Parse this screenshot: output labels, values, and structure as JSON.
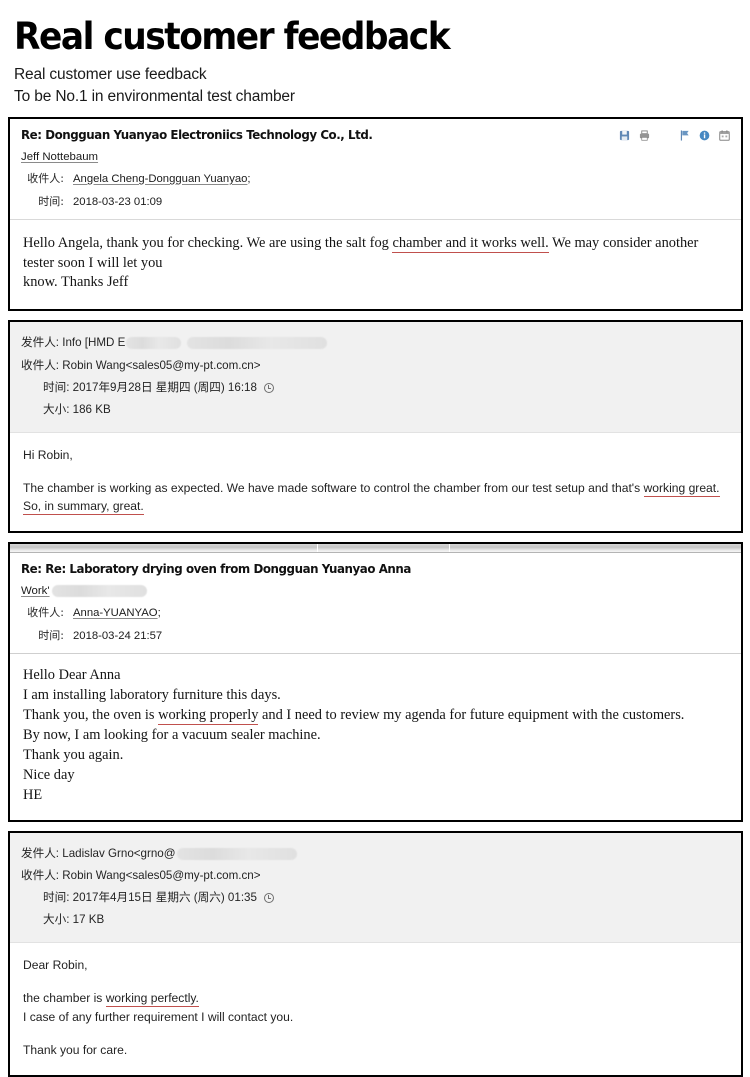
{
  "header": {
    "title": "Real customer feedback",
    "sub1": "Real customer use feedback",
    "sub2": "To be No.1 in environmental test chamber"
  },
  "accent_red": "#c0504d",
  "icons": {
    "save": "save-icon",
    "print": "print-icon",
    "flag": "flag-icon",
    "info": "info-icon",
    "calendar": "calendar-icon"
  },
  "emails": [
    {
      "style": "white",
      "subject": "Re: Dongguan Yuanyao Electroniics Technology Co., Ltd.",
      "sender": "Jeff Nottebaum",
      "to_label": "收件人:",
      "to_value": "Angela Cheng-Dongguan Yuanyao",
      "to_suffix": ";",
      "time_label": "时间:",
      "time_value": "2018-03-23 01:09",
      "body_lines": [
        {
          "parts": [
            {
              "t": "Hello Angela, thank you for checking. We are using the salt fog ",
              "hl": false
            },
            {
              "t": "chamber and it works well.",
              "hl": true
            },
            {
              "t": " We may consider another tester soon I will let you",
              "hl": false
            }
          ]
        },
        {
          "parts": [
            {
              "t": "know. Thanks Jeff",
              "hl": false
            }
          ]
        }
      ]
    },
    {
      "style": "gray",
      "from_label": "发件人:",
      "from_value": "Info [HMD E",
      "from_redacted": true,
      "to_label": "收件人:",
      "to_value": "Robin Wang<sales05@my-pt.com.cn>",
      "time_label": "时间:",
      "time_value": "2017年9月28日 星期四 (周四) 16:18",
      "size_label": "大小:",
      "size_value": "186 KB",
      "body_lines": [
        {
          "parts": [
            {
              "t": "Hi Robin,",
              "hl": false
            }
          ]
        },
        {
          "blank": true
        },
        {
          "parts": [
            {
              "t": "The chamber is working as expected. We have made software to control the chamber from our test setup and that's ",
              "hl": false
            },
            {
              "t": "working great.",
              "hl": true
            }
          ]
        },
        {
          "parts": [
            {
              "t": "So, in summary, great.",
              "hl": true
            }
          ]
        }
      ]
    },
    {
      "style": "white-chrome",
      "subject": "Re: Re: Laboratory drying oven from Dongguan Yuanyao Anna",
      "sender": "Work'",
      "sender_redacted": true,
      "to_label": "收件人:",
      "to_value": "Anna-YUANYAO",
      "to_suffix": ";",
      "time_label": "时间:",
      "time_value": "2018-03-24 21:57",
      "body_lines": [
        {
          "parts": [
            {
              "t": "Hello Dear Anna",
              "hl": false
            }
          ]
        },
        {
          "parts": [
            {
              "t": "I am installing laboratory furniture this days.",
              "hl": false
            }
          ]
        },
        {
          "parts": [
            {
              "t": "Thank you, the oven is ",
              "hl": false
            },
            {
              "t": "working properly",
              "hl": true
            },
            {
              "t": " and I need to review my agenda for future equipment with the customers.",
              "hl": false
            }
          ]
        },
        {
          "parts": [
            {
              "t": "By now, I am looking  for a vacuum sealer machine.",
              "hl": false
            }
          ]
        },
        {
          "parts": [
            {
              "t": "Thank you again.",
              "hl": false
            }
          ]
        },
        {
          "parts": [
            {
              "t": "Nice day",
              "hl": false
            }
          ]
        },
        {
          "parts": [
            {
              "t": "HE",
              "hl": false
            }
          ]
        }
      ]
    },
    {
      "style": "gray",
      "from_label": "发件人:",
      "from_value": "Ladislav Grno<grno@",
      "from_redacted": true,
      "to_label": "收件人:",
      "to_value": "Robin Wang<sales05@my-pt.com.cn>",
      "time_label": "时间:",
      "time_value": "2017年4月15日 星期六 (周六) 01:35",
      "size_label": "大小:",
      "size_value": "17 KB",
      "body_lines": [
        {
          "parts": [
            {
              "t": "Dear Robin,",
              "hl": false
            }
          ]
        },
        {
          "blank": true
        },
        {
          "parts": [
            {
              "t": "the chamber is ",
              "hl": false
            },
            {
              "t": "working perfectly.",
              "hl": true
            }
          ]
        },
        {
          "parts": [
            {
              "t": "I case of any further requirement I will contact you.",
              "hl": false
            }
          ]
        },
        {
          "blank": true
        },
        {
          "parts": [
            {
              "t": "Thank you for care.",
              "hl": false
            }
          ]
        }
      ]
    }
  ]
}
